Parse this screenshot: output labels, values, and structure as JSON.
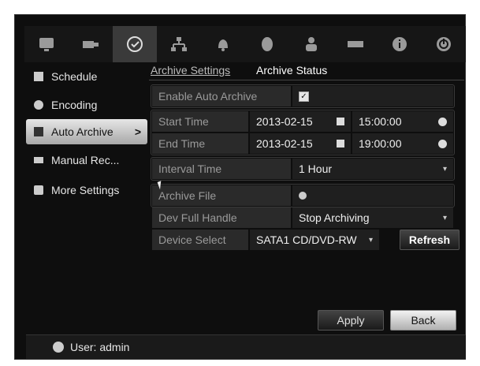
{
  "toolbar": {
    "icons": [
      {
        "name": "monitor-icon"
      },
      {
        "name": "camera-icon"
      },
      {
        "name": "record-icon"
      },
      {
        "name": "network-icon"
      },
      {
        "name": "alarm-bell-icon"
      },
      {
        "name": "hdd-icon"
      },
      {
        "name": "user-icon"
      },
      {
        "name": "device-icon"
      },
      {
        "name": "info-icon"
      },
      {
        "name": "power-icon"
      }
    ],
    "active_index": 2
  },
  "sidebar": {
    "items": [
      {
        "label": "Schedule"
      },
      {
        "label": "Encoding"
      },
      {
        "label": "Auto Archive",
        "chevron": ">"
      },
      {
        "label": "Manual Rec..."
      },
      {
        "label": "More Settings"
      }
    ]
  },
  "tabs": {
    "archive_settings": "Archive Settings",
    "archive_status": "Archive Status"
  },
  "form": {
    "enable_auto_archive_label": "Enable Auto Archive",
    "enable_auto_archive_value": "✓",
    "start_time_label": "Start Time",
    "start_date": "2013-02-15",
    "start_clock": "15:00:00",
    "end_time_label": "End Time",
    "end_date": "2013-02-15",
    "end_clock": "19:00:00",
    "interval_time_label": "Interval Time",
    "interval_time_value": "1 Hour",
    "archive_file_label": "Archive File",
    "dev_full_handle_label": "Dev Full Handle",
    "dev_full_handle_value": "Stop Archiving",
    "device_select_label": "Device Select",
    "device_select_value": "SATA1 CD/DVD-RW"
  },
  "buttons": {
    "refresh": "Refresh",
    "apply": "Apply",
    "back": "Back"
  },
  "footer": {
    "user": "User: admin"
  }
}
